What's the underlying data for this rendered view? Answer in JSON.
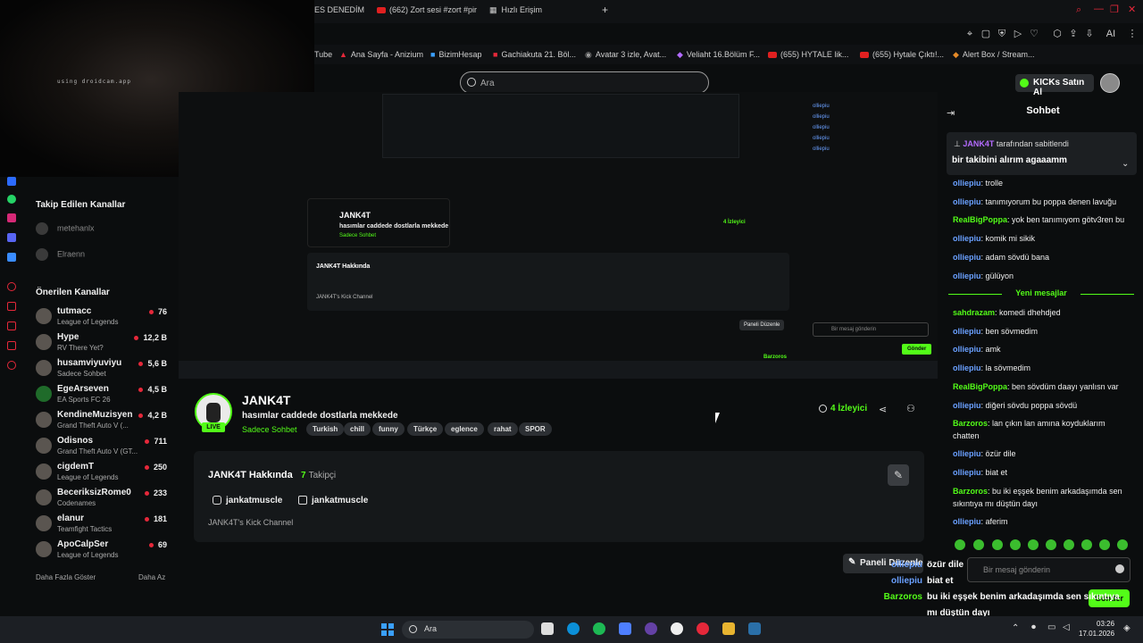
{
  "browser": {
    "tabs": [
      "ES DENEDİM",
      "(662) Zort sesi #zort #pir",
      "Hızlı Erişim"
    ],
    "bookmarks": [
      "Tube",
      "Ana Sayfa - Anizium",
      "BizimHesap",
      "Gachiakuta 21. Böl...",
      "Avatar 3 izle, Avat...",
      "Veliaht 16.Bölüm F...",
      "(655) HYTALE lik...",
      "(655) Hytale Çıktı!...",
      "Alert Box / Stream..."
    ]
  },
  "webcam": {
    "caption": "using droidcam.app"
  },
  "search": {
    "placeholder": "Ara"
  },
  "header": {
    "buy_label": "KICKs Satın Al"
  },
  "sidebar": {
    "followed_title": "Takip Edilen Kanallar",
    "followed": [
      "metehanlx",
      "Elraenn"
    ],
    "recommended_title": "Önerilen Kanallar",
    "recommended": [
      {
        "name": "tutmacc",
        "game": "League of Legends",
        "viewers": "76"
      },
      {
        "name": "Hype",
        "game": "RV There Yet?",
        "viewers": "12,2 B"
      },
      {
        "name": "husamviyuviyu",
        "game": "Sadece Sohbet",
        "viewers": "5,6 B"
      },
      {
        "name": "EgeArseven",
        "game": "EA Sports FC 26",
        "viewers": "4,5 B"
      },
      {
        "name": "KendineMuzisyen",
        "game": "Grand Theft Auto V (...",
        "viewers": "4,2 B"
      },
      {
        "name": "Odisnos",
        "game": "Grand Theft Auto V (GT...",
        "viewers": "711"
      },
      {
        "name": "cigdemT",
        "game": "League of Legends",
        "viewers": "250"
      },
      {
        "name": "BeceriksizRome0",
        "game": "Codenames",
        "viewers": "233"
      },
      {
        "name": "elanur",
        "game": "Teamfight Tactics",
        "viewers": "181"
      },
      {
        "name": "ApoCalpSer",
        "game": "League of Legends",
        "viewers": "69"
      }
    ],
    "show_more": "Daha Fazla Göster",
    "show_less": "Daha Az"
  },
  "channel": {
    "name": "JANK4T",
    "live": "LIVE",
    "title": "hasımlar caddede dostlarla mekkede",
    "category": "Sadece Sohbet",
    "tags": [
      "Turkish",
      "chill",
      "funny",
      "Türkçe",
      "eglence",
      "rahat",
      "SPOR"
    ],
    "viewers": "4 İzleyici",
    "about_title": "JANK4T Hakkında",
    "followers_count": "7",
    "followers_label": "Takipçi",
    "instagram": "jankatmuscle",
    "youtube": "jankatmuscle",
    "description": "JANK4T's Kick Channel",
    "panel_button": "Paneli Düzenle"
  },
  "chat": {
    "title": "Sohbet",
    "pinned_by": "JANK4T",
    "pinned_suffix": "tarafından sabitlendi",
    "pinned_text": "bir takibini alırım agaaamm",
    "messages": [
      {
        "user": "olliepiu",
        "text": "trolle",
        "c": "u-o"
      },
      {
        "user": "olliepiu",
        "text": "tanımıyorum bu poppa denen lavuğu",
        "c": "u-o"
      },
      {
        "user": "RealBigPoppa",
        "text": "yok ben tanımıyom götv3ren bu",
        "c": "u-g"
      },
      {
        "user": "olliepiu",
        "text": "komik mi sikik",
        "c": "u-o"
      },
      {
        "user": "olliepiu",
        "text": "adam sövdü bana",
        "c": "u-o"
      },
      {
        "user": "olliepiu",
        "text": "gülüyon",
        "c": "u-o"
      }
    ],
    "new_messages": "Yeni mesajlar",
    "messages2": [
      {
        "user": "sahdrazam",
        "text": "komedi dhehdjed",
        "c": "u-s"
      },
      {
        "user": "olliepiu",
        "text": "ben sövmedim",
        "c": "u-o"
      },
      {
        "user": "olliepiu",
        "text": "amk",
        "c": "u-o"
      },
      {
        "user": "olliepiu",
        "text": "la sövmedim",
        "c": "u-o"
      },
      {
        "user": "RealBigPoppa",
        "text": "ben sövdüm daayı yanlısn var",
        "c": "u-g"
      },
      {
        "user": "olliepiu",
        "text": "diğeri sövdu poppa sövdü",
        "c": "u-o"
      },
      {
        "user": "Barzoros",
        "text": "lan çıkın lan amına koyduklarım chatten",
        "c": "u-g"
      },
      {
        "user": "olliepiu",
        "text": "özür dile",
        "c": "u-o"
      },
      {
        "user": "olliepiu",
        "text": "biat et",
        "c": "u-o"
      },
      {
        "user": "Barzoros",
        "text": "bu iki eşşek benim arkadaşımda sen sıkıntıya mı düştün dayı",
        "c": "u-g"
      },
      {
        "user": "olliepiu",
        "text": "aferim",
        "c": "u-o"
      }
    ],
    "input_placeholder": "Bir mesaj gönderin",
    "send_label": "Gönder"
  },
  "overlay": [
    {
      "user": "olliepiu",
      "text": "özür dile"
    },
    {
      "user": "olliepiu",
      "text": "biat et"
    },
    {
      "user": "Barzoros",
      "text": "bu iki eşşek benim arkadaşımda sen sıkıntıya"
    },
    {
      "user": "",
      "text": "mı düştün dayı"
    },
    {
      "user": "olliepiu",
      "text": "aferim"
    }
  ],
  "taskbar": {
    "search": "Ara",
    "time": "03:26",
    "date": "17.01.2026"
  },
  "colors": {
    "accent": "#53fc18",
    "bg": "#0b0d0e"
  }
}
